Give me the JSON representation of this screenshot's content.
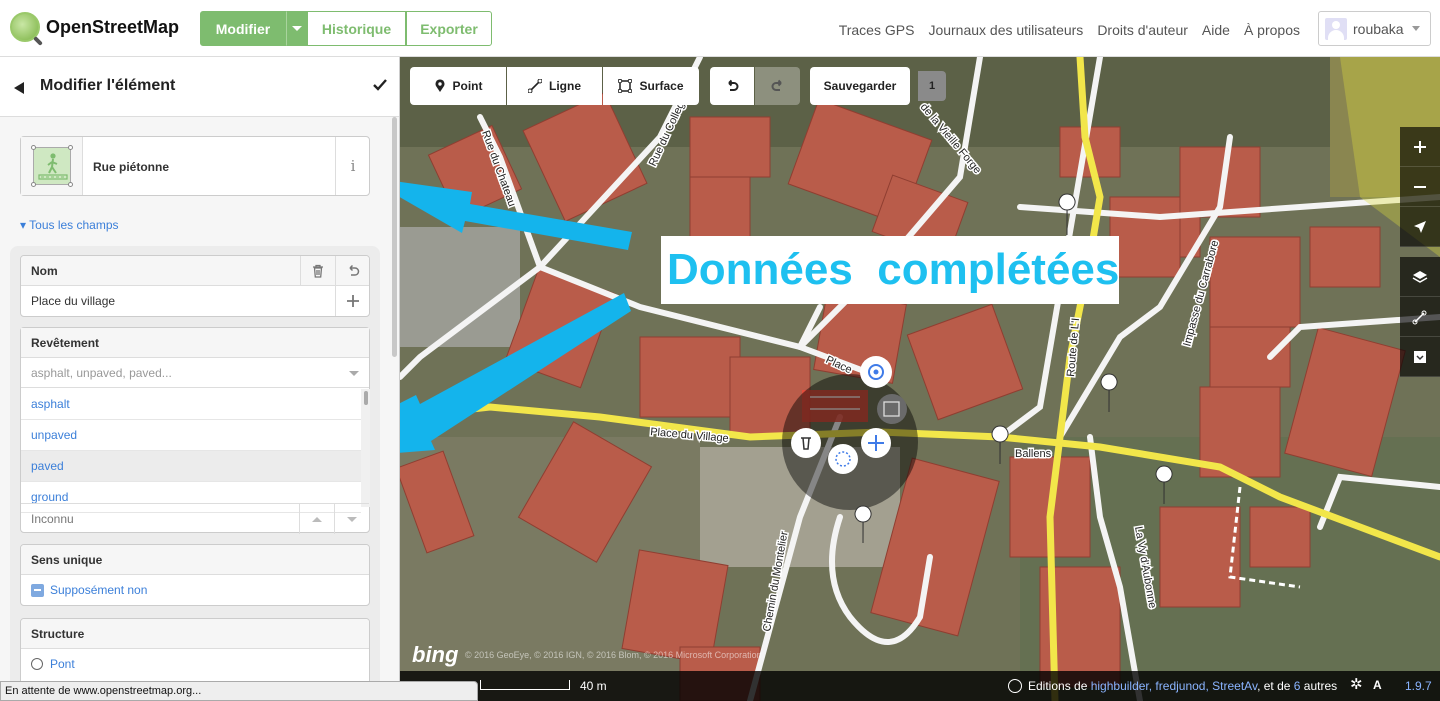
{
  "header": {
    "brand": "OpenStreetMap",
    "edit_label": "Modifier",
    "history_label": "Historique",
    "export_label": "Exporter",
    "nav": [
      "Traces GPS",
      "Journaux des utilisateurs",
      "Droits d'auteur",
      "Aide",
      "À propos"
    ],
    "username": "roubaka"
  },
  "sidebar": {
    "title": "Modifier l'élément",
    "preset_name": "Rue piétonne",
    "preset_info": "i",
    "all_fields": "▾ Tous les champs",
    "fields": {
      "name": {
        "label": "Nom",
        "value": "Place du village"
      },
      "surface": {
        "label": "Revêtement",
        "placeholder": "asphalt, unpaved, paved...",
        "options": [
          "asphalt",
          "unpaved",
          "paved",
          "ground"
        ],
        "active_option": "paved"
      },
      "unknown": {
        "value": "Inconnu"
      },
      "oneway": {
        "label": "Sens unique",
        "value": "Supposément non"
      },
      "structure": {
        "label": "Structure",
        "option": "Pont"
      }
    }
  },
  "status_bar": "En attente de www.openstreetmap.org...",
  "map": {
    "toolbar": {
      "point": "Point",
      "line": "Ligne",
      "area": "Surface",
      "save": "Sauvegarder",
      "save_count": "1"
    },
    "annotation": "Données  complétées",
    "street_labels": {
      "place_du_village": "Place du Village",
      "place": "Place",
      "rue_du_chateau": "Rue du Chateau",
      "rue_du_college": "Rue du College",
      "vieille_forge": "de la Vieille Forge",
      "route": "Route de L'I",
      "impasse": "Impasse du Carrabore",
      "ballens": "Ballens",
      "aubonne": "La Vy d'Aubonne",
      "montelier": "Chemin du Montelier"
    },
    "attribution": "© 2016 GeoEye, © 2016 IGN, © 2016 Blom, © 2016 Microsoft Corporation",
    "bing_logo": "bing",
    "scale": "40 m",
    "footer": {
      "prefix": "Editions de ",
      "authors": "highbuilder, fredjunod, StreetAv",
      "middle": ", et de ",
      "count": "6",
      "suffix": " autres",
      "version": "1.9.7"
    },
    "colors": {
      "annotation": "#1ec0f0",
      "arrow": "#14b4ec",
      "road": "#f2e64a",
      "selected": "#e84a3b",
      "osm_green": "#7ebc6f"
    }
  }
}
